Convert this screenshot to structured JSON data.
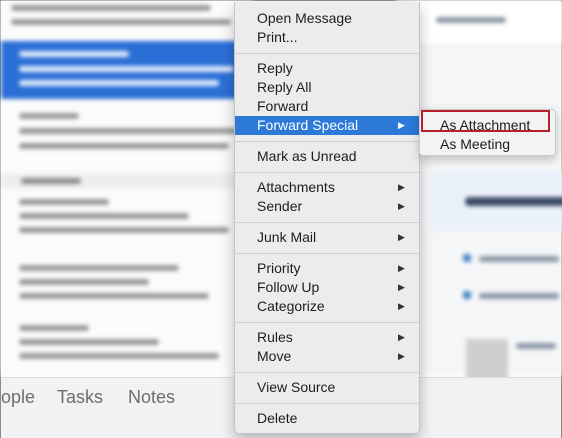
{
  "bottom_tabs": [
    {
      "label": "ople"
    },
    {
      "label": "Tasks"
    },
    {
      "label": "Notes"
    }
  ],
  "context_menu": {
    "items": [
      {
        "label": "Open Message"
      },
      {
        "label": "Print..."
      },
      {
        "label": "Reply"
      },
      {
        "label": "Reply All"
      },
      {
        "label": "Forward"
      },
      {
        "label": "Forward Special",
        "has_submenu": true,
        "highlighted": true
      },
      {
        "label": "Mark as Unread"
      },
      {
        "label": "Attachments",
        "has_submenu": true
      },
      {
        "label": "Sender",
        "has_submenu": true
      },
      {
        "label": "Junk Mail",
        "has_submenu": true
      },
      {
        "label": "Priority",
        "has_submenu": true
      },
      {
        "label": "Follow Up",
        "has_submenu": true
      },
      {
        "label": "Categorize",
        "has_submenu": true
      },
      {
        "label": "Rules",
        "has_submenu": true
      },
      {
        "label": "Move",
        "has_submenu": true
      },
      {
        "label": "View Source"
      },
      {
        "label": "Delete"
      }
    ],
    "submenu_arrow": "▶"
  },
  "forward_special_submenu": {
    "items": [
      {
        "label": "As Attachment",
        "outlined": true
      },
      {
        "label": "As Meeting"
      }
    ]
  },
  "colors": {
    "menu_highlight": "#2c79d8",
    "selected_message": "#2b6fd6",
    "annotation_outline": "#b5202a"
  }
}
